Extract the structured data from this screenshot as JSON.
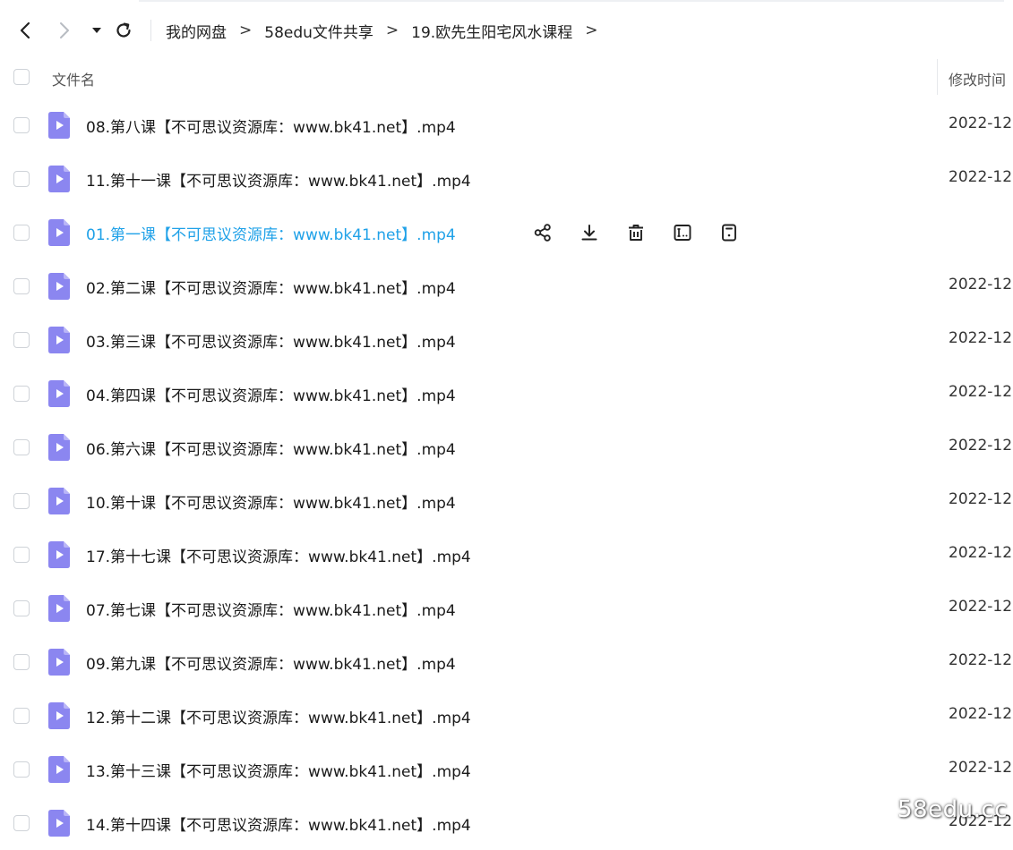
{
  "breadcrumb": {
    "items": [
      "我的网盘",
      "58edu文件共享",
      "19.欧先生阳宅风水课程"
    ],
    "separator": ">"
  },
  "table": {
    "col_name": "文件名",
    "col_time": "修改时间"
  },
  "files": [
    {
      "name": "08.第八课【不可思议资源库：www.bk41.net】.mp4",
      "time": "2022-12"
    },
    {
      "name": "11.第十一课【不可思议资源库：www.bk41.net】.mp4",
      "time": "2022-12"
    },
    {
      "name": "01.第一课【不可思议资源库：www.bk41.net】.mp4",
      "time": ""
    },
    {
      "name": "02.第二课【不可思议资源库：www.bk41.net】.mp4",
      "time": "2022-12"
    },
    {
      "name": "03.第三课【不可思议资源库：www.bk41.net】.mp4",
      "time": "2022-12"
    },
    {
      "name": "04.第四课【不可思议资源库：www.bk41.net】.mp4",
      "time": "2022-12"
    },
    {
      "name": "06.第六课【不可思议资源库：www.bk41.net】.mp4",
      "time": "2022-12"
    },
    {
      "name": "10.第十课【不可思议资源库：www.bk41.net】.mp4",
      "time": "2022-12"
    },
    {
      "name": "17.第十七课【不可思议资源库：www.bk41.net】.mp4",
      "time": "2022-12"
    },
    {
      "name": "07.第七课【不可思议资源库：www.bk41.net】.mp4",
      "time": "2022-12"
    },
    {
      "name": "09.第九课【不可思议资源库：www.bk41.net】.mp4",
      "time": "2022-12"
    },
    {
      "name": "12.第十二课【不可思议资源库：www.bk41.net】.mp4",
      "time": "2022-12"
    },
    {
      "name": "13.第十三课【不可思议资源库：www.bk41.net】.mp4",
      "time": "2022-12"
    },
    {
      "name": "14.第十四课【不可思议资源库：www.bk41.net】.mp4",
      "time": "2022-12"
    }
  ],
  "hover_row_index": 2,
  "hover_actions": [
    "share-icon",
    "download-icon",
    "delete-icon",
    "rename-icon",
    "info-icon"
  ],
  "watermark": "58edu.cc",
  "colors": {
    "link_hover": "#1fa1e8",
    "video_icon": "#8b86f0",
    "video_icon_fold": "#b9b5f7"
  },
  "icons": {
    "back": "chevron-left-icon",
    "forward": "chevron-right-icon",
    "dropdown": "caret-down-icon",
    "refresh": "refresh-icon",
    "file": "video-file-icon"
  }
}
